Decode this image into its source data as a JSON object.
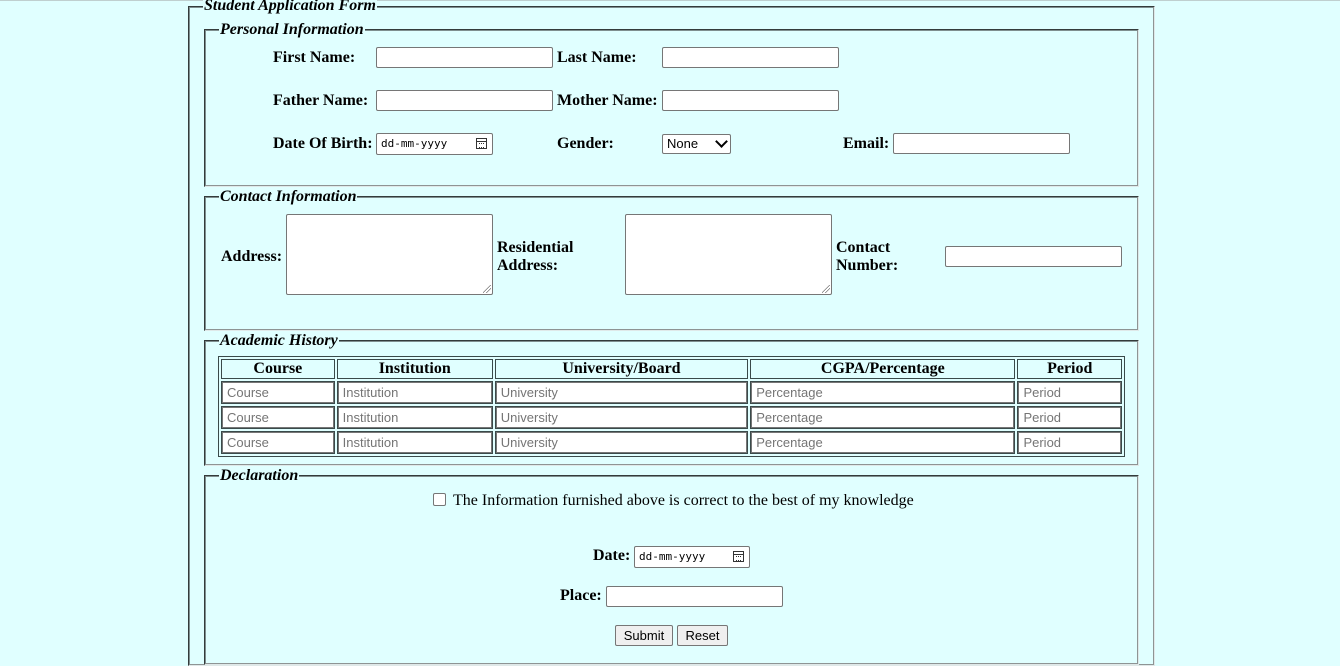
{
  "form": {
    "title": "Student Application Form"
  },
  "personal": {
    "legend": "Personal Information",
    "first_name_label": "First Name:",
    "last_name_label": "Last Name:",
    "father_name_label": "Father Name:",
    "mother_name_label": "Mother Name:",
    "dob_label": "Date Of Birth:",
    "dob_placeholder": "dd-mm-yyyy",
    "gender_label": "Gender:",
    "gender_selected": "None",
    "email_label": "Email:"
  },
  "contact": {
    "legend": "Contact Information",
    "address_label": "Address:",
    "residential_label_line1": "Residential",
    "residential_label_line2": "Address:",
    "contact_label_line1": "Contact",
    "contact_label_line2": "Number:"
  },
  "academic": {
    "legend": "Academic History",
    "headers": [
      "Course",
      "Institution",
      "University/Board",
      "CGPA/Percentage",
      "Period"
    ],
    "placeholders": [
      "Course",
      "Institution",
      "University",
      "Percentage",
      "Period"
    ]
  },
  "declaration": {
    "legend": "Declaration",
    "statement": "The Information furnished above is correct to the best of my knowledge",
    "date_label": "Date:",
    "date_placeholder": "dd-mm-yyyy",
    "place_label": "Place:",
    "submit_label": "Submit",
    "reset_label": "Reset"
  }
}
